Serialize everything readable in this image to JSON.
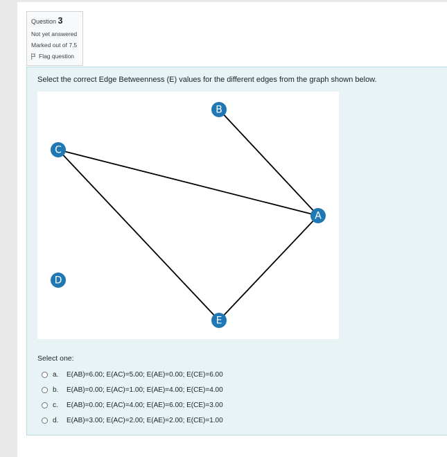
{
  "question": {
    "label": "Question",
    "number": "3",
    "status": "Not yet answered",
    "marks": "Marked out of 7.5",
    "flag_label": "Flag question"
  },
  "question_text": "Select the correct Edge Betweenness (E) values for the different edges from the graph shown below.",
  "graph": {
    "nodes": [
      {
        "id": "B"
      },
      {
        "id": "C"
      },
      {
        "id": "A"
      },
      {
        "id": "D"
      },
      {
        "id": "E"
      }
    ],
    "edges": [
      [
        "B",
        "A"
      ],
      [
        "C",
        "A"
      ],
      [
        "C",
        "E"
      ],
      [
        "E",
        "A"
      ]
    ],
    "node_color": "#1f78b4"
  },
  "select_label": "Select one:",
  "options": [
    {
      "letter": "a.",
      "text": "E(AB)=6.00; E(AC)=5.00; E(AE)=0.00; E(CE)=6.00"
    },
    {
      "letter": "b.",
      "text": "E(AB)=0.00; E(AC)=1.00; E(AE)=4.00; E(CE)=4.00"
    },
    {
      "letter": "c.",
      "text": "E(AB)=0.00; E(AC)=4.00; E(AE)=6.00; E(CE)=3.00"
    },
    {
      "letter": "d.",
      "text": "E(AB)=3.00; E(AC)=2.00; E(AE)=2.00; E(CE)=1.00"
    }
  ]
}
